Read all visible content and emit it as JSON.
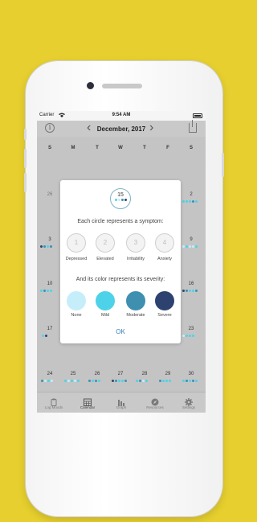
{
  "status_bar": {
    "carrier": "Carrier",
    "time": "9:54 AM",
    "wifi_icon": "wifi-icon",
    "battery_icon": "battery-icon"
  },
  "nav": {
    "title": "December, 2017",
    "info_icon": "info-icon",
    "prev_icon": "chevron-left-icon",
    "next_icon": "chevron-right-icon",
    "share_icon": "share-icon"
  },
  "weekdays": [
    "S",
    "M",
    "T",
    "W",
    "T",
    "F",
    "S"
  ],
  "calendar_days": {
    "d26": "26",
    "d2": "2",
    "d3": "3",
    "d9": "9",
    "d10": "10",
    "d16": "16",
    "d17": "17",
    "d23": "23",
    "d24": "24",
    "d25": "25",
    "d26b": "26",
    "d27": "27",
    "d28": "28",
    "d29": "29",
    "d30": "30"
  },
  "severity_colors": {
    "none": "#c5eefa",
    "mild": "#4dd2e9",
    "moderate": "#3e8fb0",
    "severe": "#2e4270"
  },
  "modal": {
    "sample_number": "15",
    "line1": "Each circle represents a symptom:",
    "symptoms": [
      {
        "num": "1",
        "label": "Depressed"
      },
      {
        "num": "2",
        "label": "Elevated"
      },
      {
        "num": "3",
        "label": "Irritability"
      },
      {
        "num": "4",
        "label": "Anxiety"
      }
    ],
    "line2": "And its color represents its severity:",
    "severities": [
      {
        "label": "None"
      },
      {
        "label": "Mild"
      },
      {
        "label": "Moderate"
      },
      {
        "label": "Severe"
      }
    ],
    "ok": "OK"
  },
  "tabs": [
    {
      "label": "Log Moods",
      "icon": "clipboard-icon"
    },
    {
      "label": "Calendar",
      "icon": "calendar-icon"
    },
    {
      "label": "Graph",
      "icon": "bar-chart-icon"
    },
    {
      "label": "Resources",
      "icon": "compass-icon"
    },
    {
      "label": "Settings",
      "icon": "gear-icon"
    }
  ]
}
